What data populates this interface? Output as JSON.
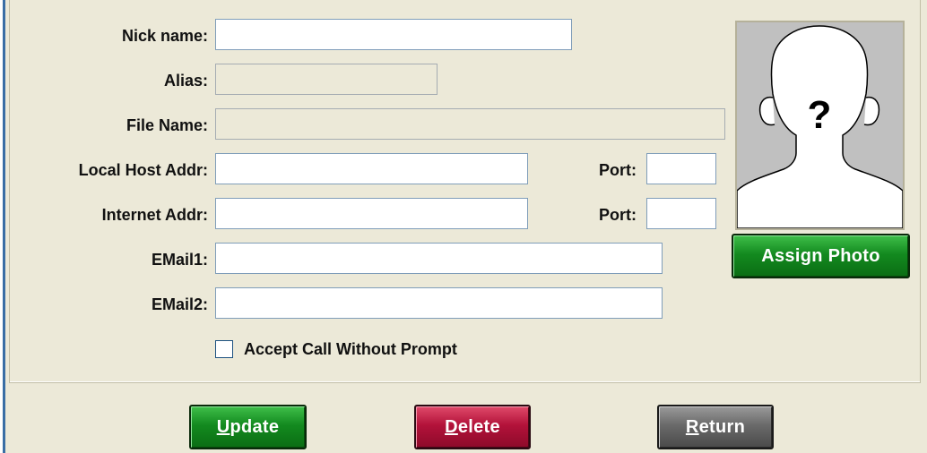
{
  "form": {
    "nick_name_label": "Nick name:",
    "nick_name_value": "",
    "alias_label": "Alias:",
    "alias_value": "",
    "file_name_label": "File Name:",
    "file_name_value": "",
    "local_host_label": "Local Host Addr:",
    "local_host_value": "",
    "local_port_label": "Port:",
    "local_port_value": "",
    "internet_addr_label": "Internet Addr:",
    "internet_addr_value": "",
    "internet_port_label": "Port:",
    "internet_port_value": "",
    "email1_label": "EMail1:",
    "email1_value": "",
    "email2_label": "EMail2:",
    "email2_value": "",
    "accept_call_label": "Accept Call Without Prompt",
    "accept_call_checked": false
  },
  "photo": {
    "placeholder_glyph": "?",
    "assign_button_label": "Assign Photo"
  },
  "actions": {
    "update": {
      "mnemonic": "U",
      "rest": "pdate"
    },
    "delete": {
      "mnemonic": "D",
      "rest": "elete"
    },
    "return": {
      "mnemonic": "R",
      "rest": "eturn"
    }
  },
  "colors": {
    "background": "#ece9d8",
    "green_button": "#138a1f",
    "red_button": "#b3123a",
    "gray_button": "#6a6a6a",
    "field_border": "#7f9db9"
  }
}
